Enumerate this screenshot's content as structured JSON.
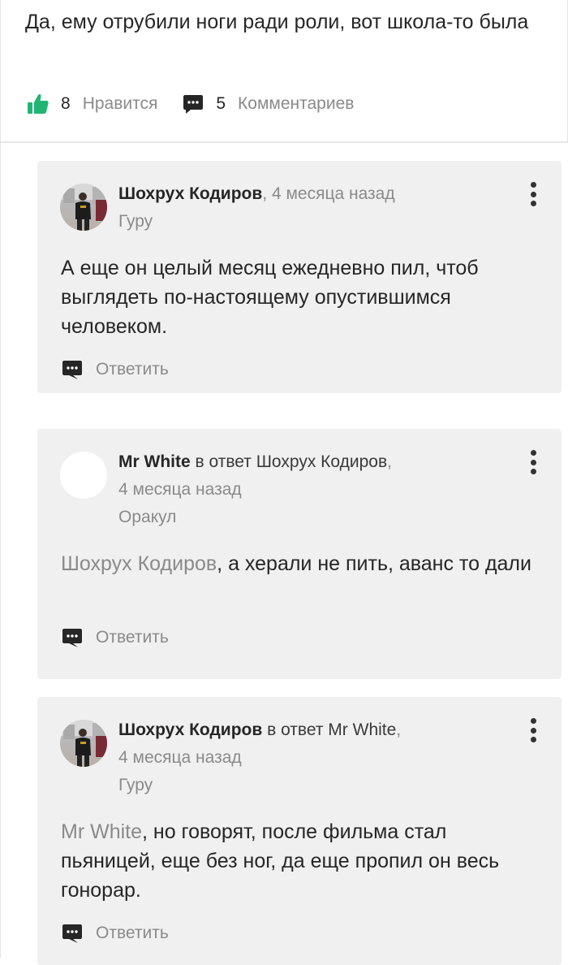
{
  "post": {
    "text": "Да, ему отрубили ноги ради роли, вот школа-то была",
    "likes": {
      "count": "8",
      "label": "Нравится"
    },
    "comments": {
      "count": "5",
      "label": "Комментариев"
    }
  },
  "colors": {
    "like_icon": "#21b573",
    "text": "#262626",
    "muted": "#8a8a8a",
    "card_bg": "#f0f0f0"
  },
  "comments": [
    {
      "author": "Шохрух Кодиров",
      "separator": ", ",
      "time": "4 месяца назад",
      "rank": "Гуру",
      "avatar": "user-photo",
      "text": "А еще он целый месяц ежедневно пил, чтоб выглядеть по-настоящему опустившимся человеком.",
      "reply_label": "Ответить"
    },
    {
      "author": "Mr White",
      "reply_to_prefix": " в ответ ",
      "reply_to": "Шохрух Кодиров",
      "separator": ",",
      "time": "4 месяца назад",
      "rank": "Оракул",
      "avatar": "empty",
      "mention": "Шохрух Кодиров",
      "text": ", а херали не пить, аванс то дали",
      "reply_label": "Ответить"
    },
    {
      "author": "Шохрух Кодиров",
      "reply_to_prefix": " в ответ ",
      "reply_to": "Mr White",
      "separator": ",",
      "time": "4 месяца назад",
      "rank": "Гуру",
      "avatar": "user-photo",
      "mention": "Mr White",
      "text": ", но говорят, после фильма стал пьяницей, еще без ног, да еще пропил он весь гонорар.",
      "reply_label": "Ответить"
    }
  ]
}
